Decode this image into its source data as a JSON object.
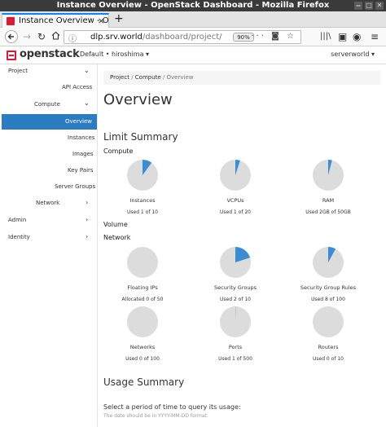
{
  "window": {
    "title": "Instance Overview - OpenStack Dashboard - Mozilla Firefox"
  },
  "browser": {
    "tab_title": "Instance Overview - Ope",
    "url_host": "dlp.srv.world",
    "url_path": "/dashboard/project/",
    "zoom": "90%",
    "buttons": {
      "close": "✕",
      "minimize": "‒",
      "maximize": "□"
    }
  },
  "header": {
    "logo": "openstack",
    "project_selector": "Default • hiroshima ▾",
    "user_menu": "serverworld ▾"
  },
  "sidebar": {
    "project": "Project",
    "api_access": "API Access",
    "compute": "Compute",
    "overview": "Overview",
    "instances": "Instances",
    "images": "Images",
    "key_pairs": "Key Pairs",
    "server_groups": "Server Groups",
    "network": "Network",
    "admin": "Admin",
    "identity": "Identity"
  },
  "breadcrumb": {
    "project": "Project",
    "compute": "Compute",
    "current": "Overview"
  },
  "main": {
    "title": "Overview",
    "limit_summary": "Limit Summary",
    "compute_heading": "Compute",
    "volume_heading": "Volume",
    "network_heading": "Network",
    "usage_summary": "Usage Summary",
    "usage_prompt": "Select a period of time to query its usage:",
    "usage_hint": "The date should be in YYYY-MM-DD format."
  },
  "colors": {
    "accent": "#2b7cc1",
    "pie_used": "#3a8dd3",
    "pie_free": "#dcdcdc",
    "brand": "#da1a32"
  },
  "chart_data": {
    "type": "pie",
    "compute": [
      {
        "title": "Instances",
        "usage": "Used 1 of 10",
        "used": 1,
        "total": 10
      },
      {
        "title": "VCPUs",
        "usage": "Used 1 of 20",
        "used": 1,
        "total": 20
      },
      {
        "title": "RAM",
        "usage": "Used 2GB of 50GB",
        "used": 2,
        "total": 50
      }
    ],
    "network": [
      {
        "title": "Floating IPs",
        "usage": "Allocated 0 of 50",
        "used": 0,
        "total": 50
      },
      {
        "title": "Security Groups",
        "usage": "Used 2 of 10",
        "used": 2,
        "total": 10
      },
      {
        "title": "Security Group Rules",
        "usage": "Used 8 of 100",
        "used": 8,
        "total": 100
      },
      {
        "title": "Networks",
        "usage": "Used 0 of 100",
        "used": 0,
        "total": 100
      },
      {
        "title": "Ports",
        "usage": "Used 1 of 500",
        "used": 1,
        "total": 500
      },
      {
        "title": "Routers",
        "usage": "Used 0 of 10",
        "used": 0,
        "total": 10
      }
    ]
  }
}
